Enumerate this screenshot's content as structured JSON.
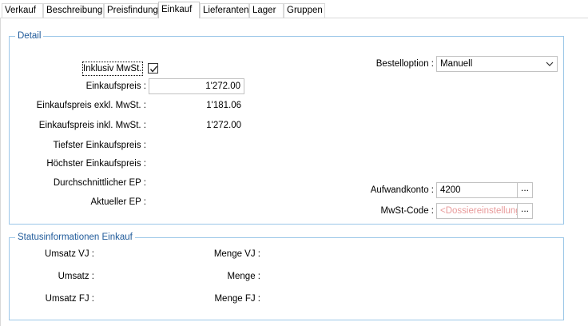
{
  "tabs": [
    "Verkauf",
    "Beschreibung",
    "Preisfindung",
    "Einkauf",
    "Lieferanten",
    "Lager",
    "Gruppen"
  ],
  "active_tab": "Einkauf",
  "detail": {
    "title": "Detail",
    "inklusiv_label": "Inklusiv MwSt.",
    "inklusiv_checked": true,
    "einkaufspreis_label": "Einkaufspreis :",
    "einkaufspreis_value": "1'272.00",
    "ep_exkl_label": "Einkaufspreis exkl. MwSt. :",
    "ep_exkl_value": "1'181.06",
    "ep_inkl_label": "Einkaufspreis inkl. MwSt. :",
    "ep_inkl_value": "1'272.00",
    "tiefster_label": "Tiefster Einkaufspreis :",
    "hoechster_label": "Höchster Einkaufspreis :",
    "durchschnitt_label": "Durchschnittlicher EP :",
    "aktueller_label": "Aktueller EP :",
    "bestelloption_label": "Bestelloption :",
    "bestelloption_value": "Manuell",
    "aufwandkonto_label": "Aufwandkonto :",
    "aufwandkonto_value": "4200",
    "mwst_code_label": "MwSt-Code :",
    "mwst_code_value": "<Dossiereinstellunge",
    "browse_label": "..."
  },
  "status": {
    "title": "Statusinformationen Einkauf",
    "umsatz_vj_label": "Umsatz VJ :",
    "umsatz_label": "Umsatz :",
    "umsatz_fj_label": "Umsatz FJ :",
    "menge_vj_label": "Menge VJ :",
    "menge_label": "Menge :",
    "menge_fj_label": "Menge FJ :"
  }
}
